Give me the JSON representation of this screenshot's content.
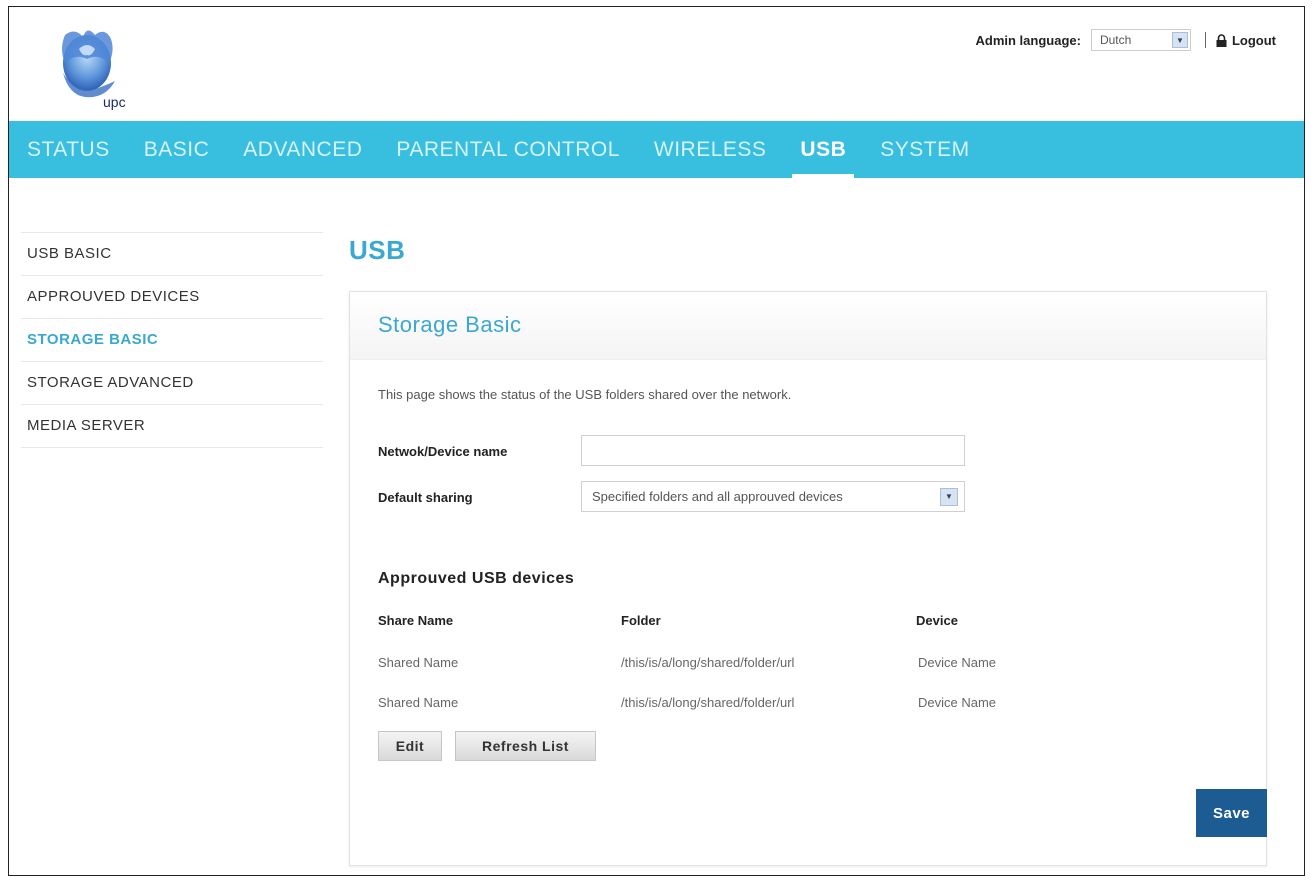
{
  "header": {
    "logo_text": "upc",
    "admin_language_label": "Admin language:",
    "admin_language_value": "Dutch",
    "logout_label": "Logout"
  },
  "nav": {
    "items": [
      {
        "label": "STATUS"
      },
      {
        "label": "BASIC"
      },
      {
        "label": "ADVANCED"
      },
      {
        "label": "PARENTAL CONTROL"
      },
      {
        "label": "WIRELESS"
      },
      {
        "label": "USB",
        "active": true
      },
      {
        "label": "SYSTEM"
      }
    ]
  },
  "sidebar": {
    "items": [
      {
        "label": "USB BASIC"
      },
      {
        "label": "APPROUVED DEVICES"
      },
      {
        "label": "STORAGE BASIC",
        "active": true
      },
      {
        "label": "STORAGE ADVANCED"
      },
      {
        "label": "MEDIA SERVER"
      }
    ]
  },
  "main": {
    "title": "USB",
    "panel_title": "Storage Basic",
    "description": "This page shows the status of the USB folders shared over the network.",
    "device_name_label": "Netwok/Device name",
    "device_name_value": "",
    "default_sharing_label": "Default sharing",
    "default_sharing_value": "Specified folders and all approuved devices",
    "devices_section_title": "Approuved USB devices",
    "table": {
      "headers": [
        "Share Name",
        "Folder",
        "Device"
      ],
      "rows": [
        [
          "Shared Name",
          "/this/is/a/long/shared/folder/url",
          "Device Name"
        ],
        [
          "Shared Name",
          "/this/is/a/long/shared/folder/url",
          "Device Name"
        ]
      ]
    },
    "edit_label": "Edit",
    "refresh_label": "Refresh List",
    "save_label": "Save"
  },
  "colors": {
    "nav_bg": "#38bede",
    "accent": "#3aa8d0",
    "save_button": "#1d5b93"
  }
}
